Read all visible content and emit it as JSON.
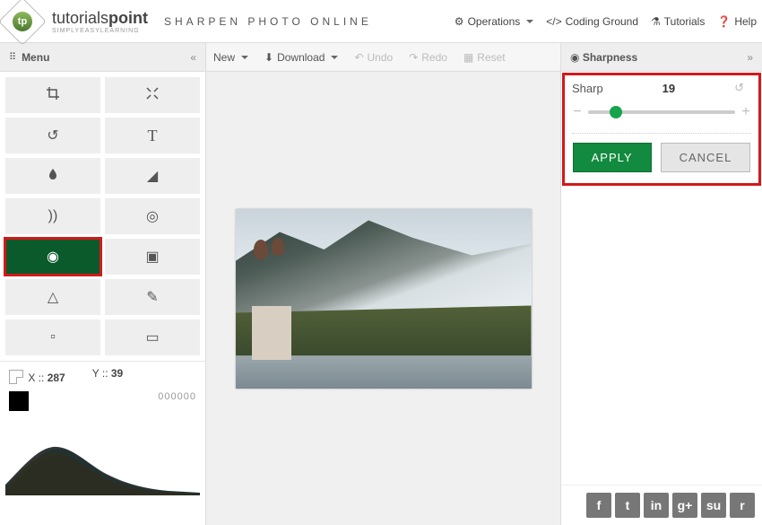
{
  "header": {
    "brand_main": "tutorials",
    "brand_bold": "point",
    "brand_tag": "SIMPLYEASYLEARNING",
    "page_title": "SHARPEN PHOTO ONLINE",
    "nav": {
      "operations": "Operations",
      "coding": "Coding Ground",
      "tutorials": "Tutorials",
      "help": "Help"
    }
  },
  "toolbar": {
    "menu_label": "Menu",
    "new_label": "New",
    "download_label": "Download",
    "undo_label": "Undo",
    "redo_label": "Redo",
    "reset_label": "Reset",
    "right_title": "Sharpness"
  },
  "sidebar": {
    "coords": {
      "x_label": "X ::",
      "x_val": "287",
      "y_label": "Y ::",
      "y_val": "39"
    },
    "zeros": "000000",
    "tools": [
      {
        "name": "crop"
      },
      {
        "name": "fullscreen"
      },
      {
        "name": "rotate"
      },
      {
        "name": "text"
      },
      {
        "name": "drop"
      },
      {
        "name": "exposure"
      },
      {
        "name": "waves"
      },
      {
        "name": "contrast"
      },
      {
        "name": "eye",
        "active": true
      },
      {
        "name": "image"
      },
      {
        "name": "color"
      },
      {
        "name": "brush"
      },
      {
        "name": "resize"
      },
      {
        "name": "frame"
      }
    ]
  },
  "panel": {
    "label": "Sharp",
    "value": "19",
    "slider_percent": 19,
    "apply": "APPLY",
    "cancel": "CANCEL"
  },
  "social": [
    "f",
    "t",
    "in",
    "g+",
    "su",
    "r"
  ]
}
